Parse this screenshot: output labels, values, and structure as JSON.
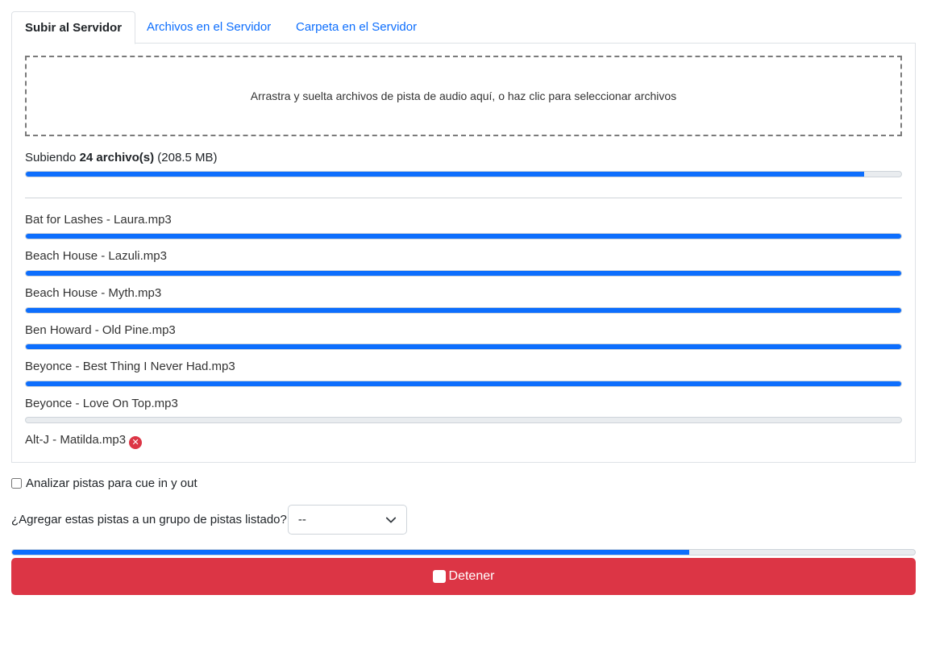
{
  "tabs": [
    {
      "label": "Subir al Servidor",
      "active": true
    },
    {
      "label": "Archivos en el Servidor",
      "active": false
    },
    {
      "label": "Carpeta en el Servidor",
      "active": false
    }
  ],
  "dropzone": {
    "text": "Arrastra y suelta archivos de pista de audio aquí, o haz clic para seleccionar archivos"
  },
  "summary": {
    "prefix": "Subiendo",
    "count": "24 archivo(s)",
    "size": "(208.5 MB)",
    "progress": 0.958
  },
  "files": [
    {
      "name": "Bat for Lashes - Laura.mp3",
      "progress": 1.0
    },
    {
      "name": "Beach House - Lazuli.mp3",
      "progress": 1.0
    },
    {
      "name": "Beach House - Myth.mp3",
      "progress": 1.0
    },
    {
      "name": "Ben Howard - Old Pine.mp3",
      "progress": 1.0
    },
    {
      "name": "Beyonce - Best Thing I Never Had.mp3",
      "progress": 1.0
    },
    {
      "name": "Beyonce - Love On Top.mp3",
      "progress": 0.0
    },
    {
      "name": "Alt-J - Matilda.mp3",
      "error": true,
      "error_icon": "error-x-icon"
    }
  ],
  "analyze": {
    "label": "Analizar pistas para cue in y out",
    "checked": false
  },
  "group": {
    "label": "¿Agregar estas pistas a un grupo de pistas listado?",
    "selected": "--"
  },
  "overall_progress": 0.75,
  "stop_button": {
    "label": "Detener",
    "icon": "stop-icon"
  },
  "colors": {
    "accent": "#0d6efd",
    "danger": "#dc3545",
    "track": "#e9ecef"
  }
}
